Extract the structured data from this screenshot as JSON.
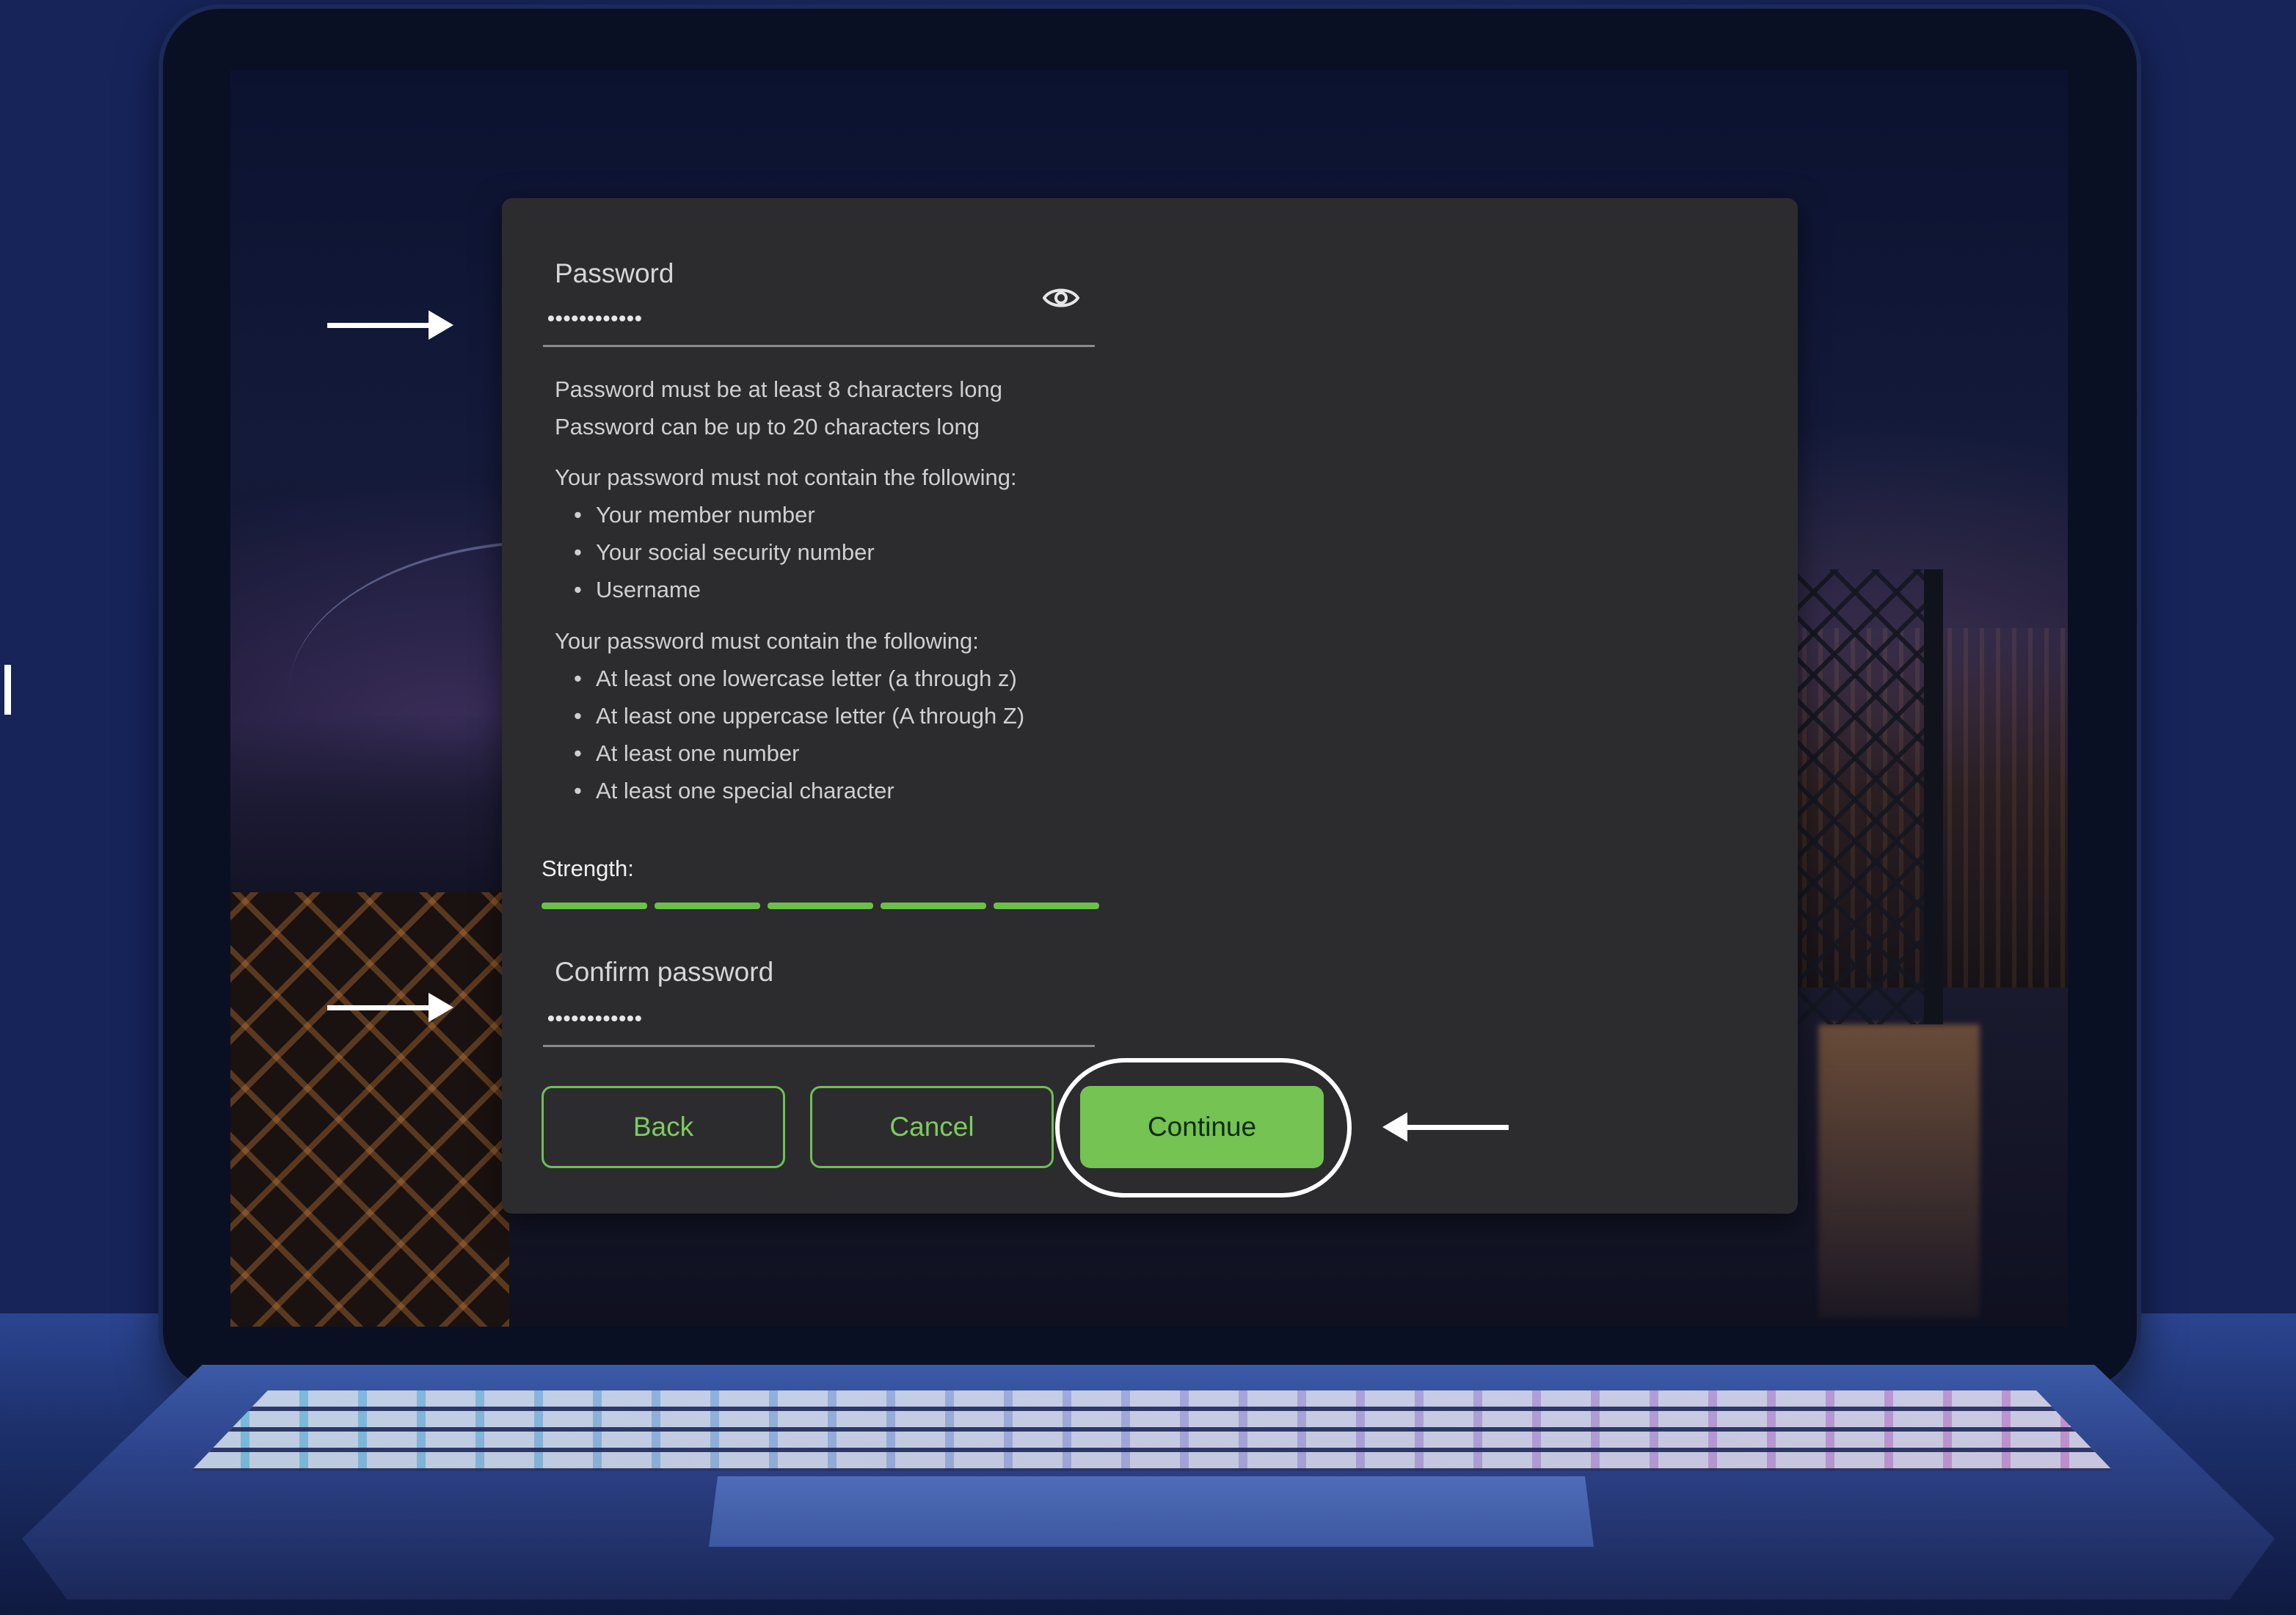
{
  "password": {
    "label": "Password",
    "value": "••••••••••••",
    "toggle_icon": "eye-icon"
  },
  "length_rules": [
    "Password must be at least 8 characters long",
    "Password can be up to 20 characters long"
  ],
  "must_not_contain": {
    "heading": "Your password must not contain the following:",
    "items": [
      "Your member number",
      "Your social security number",
      "Username"
    ]
  },
  "must_contain": {
    "heading": "Your password must contain the following:",
    "items": [
      "At least one lowercase letter (a through z)",
      "At least one uppercase letter (A through Z)",
      "At least one number",
      "At least one special character"
    ]
  },
  "strength": {
    "label": "Strength:",
    "level": 5,
    "max": 5,
    "color": "#6cc04a"
  },
  "confirm": {
    "label": "Confirm password",
    "value": "••••••••••••"
  },
  "buttons": {
    "back": "Back",
    "cancel": "Cancel",
    "continue": "Continue"
  },
  "colors": {
    "accent": "#74c353",
    "dialog_bg": "#2c2c2e"
  }
}
